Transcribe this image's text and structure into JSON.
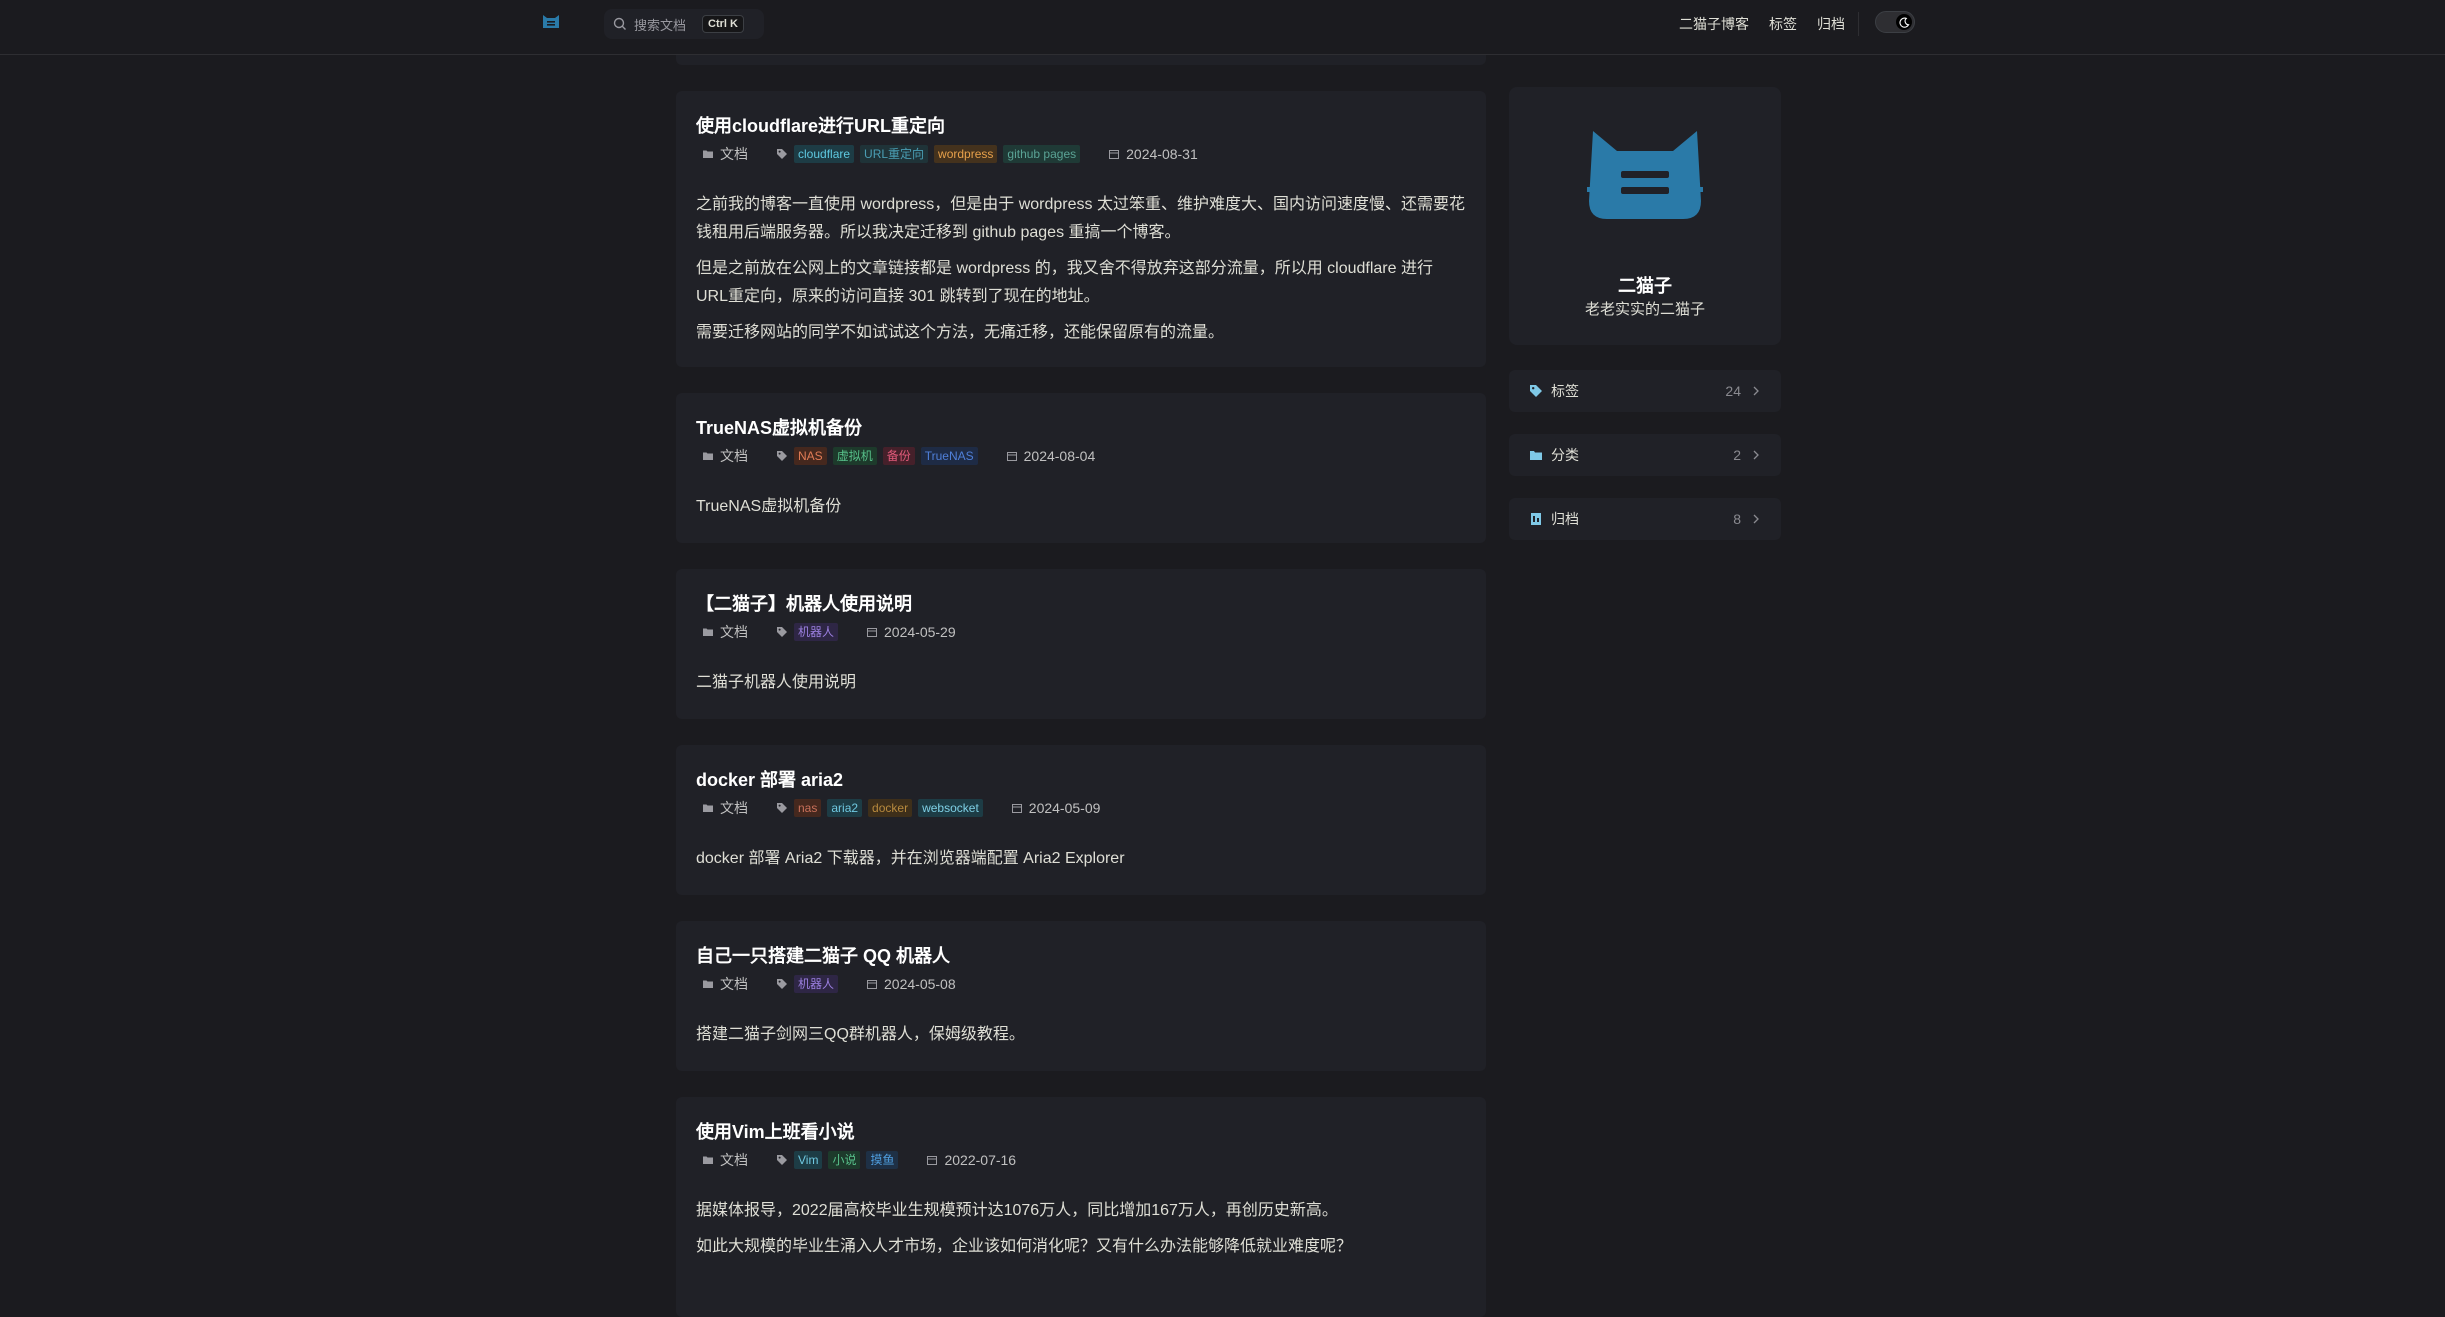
{
  "nav": {
    "search_placeholder": "搜索文档",
    "search_shortcut": "Ctrl K",
    "links": [
      "二猫子博客",
      "标签",
      "归档"
    ]
  },
  "posts": [
    {
      "title": "使用cloudflare进行URL重定向",
      "category": "文档",
      "tags": [
        {
          "text": "cloudflare",
          "color": "#5ec8e0",
          "bg": "#1d3c45"
        },
        {
          "text": "URL重定向",
          "color": "#4a9db3",
          "bg": "#1f3338"
        },
        {
          "text": "wordpress",
          "color": "#e6a04b",
          "bg": "#44321d"
        },
        {
          "text": "github pages",
          "color": "#5aa395",
          "bg": "#1f3a36"
        }
      ],
      "date": "2024-08-31",
      "paragraphs": [
        "之前我的博客一直使用 wordpress，但是由于 wordpress 太过笨重、维护难度大、国内访问速度慢、还需要花钱租用后端服务器。所以我决定迁移到 github pages 重搞一个博客。",
        "但是之前放在公网上的文章链接都是 wordpress 的，我又舍不得放弃这部分流量，所以用 cloudflare 进行 URL重定向，原来的访问直接 301 跳转到了现在的地址。",
        "需要迁移网站的同学不如试试这个方法，无痛迁移，还能保留原有的流量。"
      ]
    },
    {
      "title": "TrueNAS虚拟机备份",
      "category": "文档",
      "tags": [
        {
          "text": "NAS",
          "color": "#e07b56",
          "bg": "#45281e"
        },
        {
          "text": "虚拟机",
          "color": "#57c08a",
          "bg": "#1d3a2b"
        },
        {
          "text": "备份",
          "color": "#e05a7a",
          "bg": "#45202a"
        },
        {
          "text": "TrueNAS",
          "color": "#4f7fd8",
          "bg": "#1e2b45"
        }
      ],
      "date": "2024-08-04",
      "paragraphs": [
        "TrueNAS虚拟机备份"
      ]
    },
    {
      "title": "【二猫子】机器人使用说明",
      "category": "文档",
      "tags": [
        {
          "text": "机器人",
          "color": "#9b7fe0",
          "bg": "#2e2645"
        }
      ],
      "date": "2024-05-29",
      "paragraphs": [
        "二猫子机器人使用说明"
      ]
    },
    {
      "title": "docker 部署 aria2",
      "category": "文档",
      "tags": [
        {
          "text": "nas",
          "color": "#c9705a",
          "bg": "#45281e"
        },
        {
          "text": "aria2",
          "color": "#6fc8e0",
          "bg": "#1d3c45"
        },
        {
          "text": "docker",
          "color": "#b88a3e",
          "bg": "#3e2f1a"
        },
        {
          "text": "websocket",
          "color": "#7fd0e6",
          "bg": "#1d3c45"
        }
      ],
      "date": "2024-05-09",
      "paragraphs": [
        "docker 部署 Aria2 下载器，并在浏览器端配置 Aria2 Explorer"
      ]
    },
    {
      "title": "自己一只搭建二猫子 QQ 机器人",
      "category": "文档",
      "tags": [
        {
          "text": "机器人",
          "color": "#9b7fe0",
          "bg": "#2e2645"
        }
      ],
      "date": "2024-05-08",
      "paragraphs": [
        "搭建二猫子剑网三QQ群机器人，保姆级教程。"
      ]
    },
    {
      "title": "使用Vim上班看小说",
      "category": "文档",
      "tags": [
        {
          "text": "Vim",
          "color": "#6fc8e0",
          "bg": "#1d3c45"
        },
        {
          "text": "小说",
          "color": "#57c08a",
          "bg": "#1d3a2b"
        },
        {
          "text": "摸鱼",
          "color": "#4f9fe0",
          "bg": "#1e3045"
        }
      ],
      "date": "2022-07-16",
      "paragraphs": [
        "据媒体报导，2022届高校毕业生规模预计达1076万人，同比增加167万人，再创历史新高。",
        "如此大规模的毕业生涌入人才市场，企业该如何消化呢？又有什么办法能够降低就业难度呢？"
      ]
    }
  ],
  "profile": {
    "name": "二猫子",
    "motto": "老老实实的二猫子"
  },
  "sidebar": [
    {
      "label": "标签",
      "count": "24",
      "icon": "tag-icon"
    },
    {
      "label": "分类",
      "count": "2",
      "icon": "folder-icon"
    },
    {
      "label": "归档",
      "count": "8",
      "icon": "archive-icon"
    }
  ],
  "colors": {
    "accent": "#2a7aa8",
    "background": "#1b1b1f",
    "card": "#202127"
  }
}
